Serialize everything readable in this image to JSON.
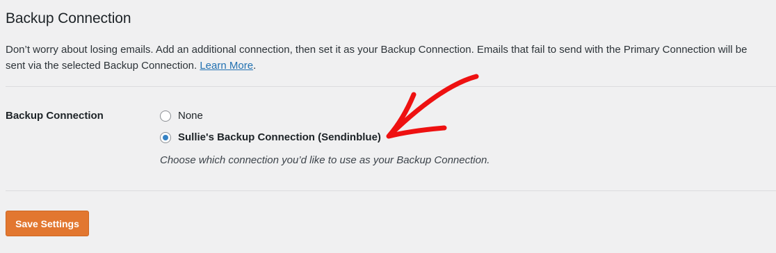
{
  "section": {
    "title": "Backup Connection",
    "description_text": "Don’t worry about losing emails. Add an additional connection, then set it as your Backup Connection. Emails that fail to send with the Primary Connection will be sent via the selected Backup Connection.",
    "learn_more_label": "Learn More",
    "description_end": "."
  },
  "field": {
    "label": "Backup Connection",
    "options": [
      {
        "label": "None",
        "selected": false
      },
      {
        "label": "Sullie's Backup Connection (Sendinblue)",
        "selected": true
      }
    ],
    "hint": "Choose which connection you’d like to use as your Backup Connection."
  },
  "actions": {
    "save_label": "Save Settings"
  },
  "colors": {
    "accent": "#e27730",
    "link": "#2271b1",
    "radio_selected": "#3582c4",
    "annotation": "#ee1111"
  }
}
